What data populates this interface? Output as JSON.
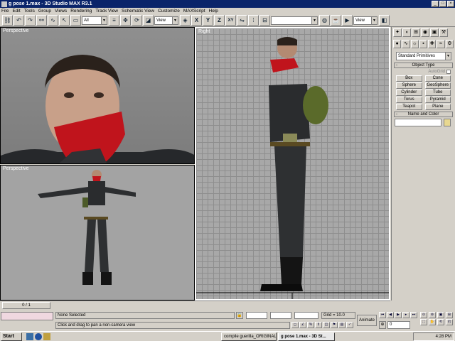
{
  "window": {
    "title": "g pose 1.max - 3D Studio MAX R3.1",
    "controls": [
      "_",
      "□",
      "×"
    ]
  },
  "menu": [
    "File",
    "Edit",
    "Tools",
    "Group",
    "Views",
    "Rendering",
    "Track View",
    "Schematic View",
    "Customize",
    "MAXScript",
    "Help"
  ],
  "toolbar": {
    "selection_filter": "All",
    "ref_coord": "View",
    "named_selection": "",
    "view_combo": "View",
    "axis_labels": [
      "X",
      "Y",
      "Z",
      "XY"
    ]
  },
  "viewports": {
    "top_left": "Perspective",
    "bottom_left": "Perspective",
    "right": "Right"
  },
  "command_panel": {
    "category": "Standard Primitives",
    "object_type_rollout": "Object Type",
    "autogrid": "AutoGrid",
    "buttons": [
      "Box",
      "Cone",
      "Sphere",
      "GeoSphere",
      "Cylinder",
      "Tube",
      "Torus",
      "Pyramid",
      "Teapot",
      "Plane"
    ],
    "name_color_rollout": "Name and Color"
  },
  "timeline": {
    "frame": "0 / 1"
  },
  "status": {
    "selection": "None Selected",
    "prompt": "Click and drag to pan a non-camera view",
    "grid": "Grid = 10.0",
    "animate": "Animate",
    "frame_field": "0"
  },
  "taskbar": {
    "start": "Start",
    "tasks": [
      "compile guerilla_ORIGINAL",
      "g pose 1.max - 3D St..."
    ],
    "clock": "4:28 PM"
  },
  "colors": {
    "title": "#0a246a",
    "bandana": "#c0141c",
    "uniform": "#2a2c2e",
    "pack": "#5a6a2a"
  }
}
